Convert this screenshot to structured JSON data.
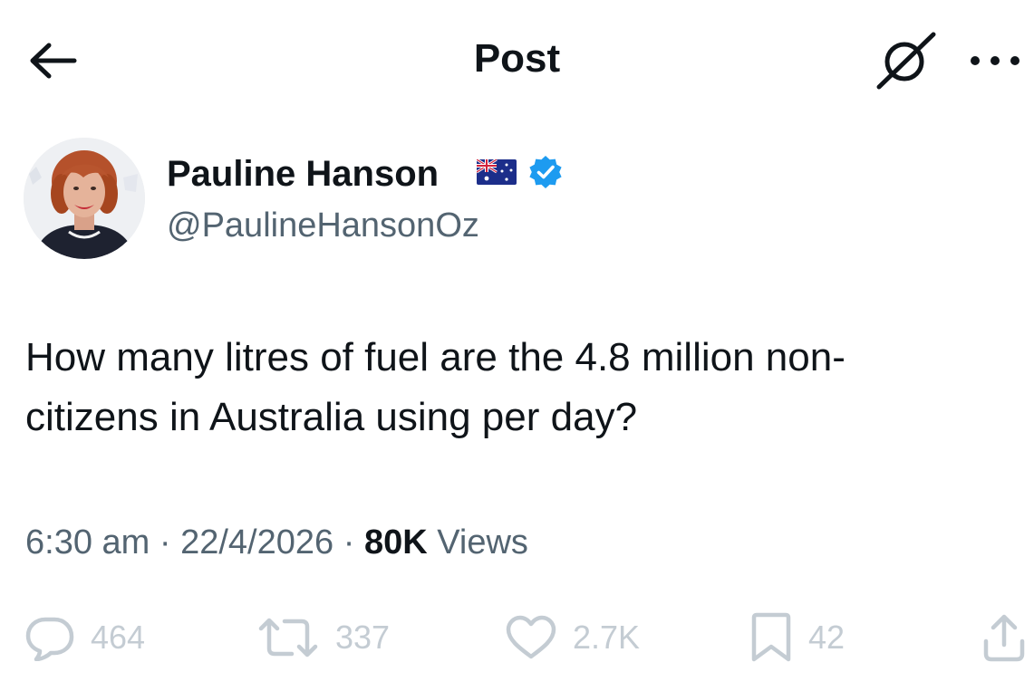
{
  "header": {
    "title": "Post",
    "back_icon": "arrow-left-icon",
    "grok_icon": "grok-icon",
    "more_icon": "more-horizontal-icon"
  },
  "author": {
    "name": "Pauline Hanson",
    "handle": "@PaulineHansonOz",
    "flag": "australian-flag-emoji",
    "verified": true,
    "verified_color": "#1d9bf0"
  },
  "tweet": {
    "text_line1": "How many litres of fuel are the 4.8 million non-",
    "text_line2": "citizens in Australia using per day?"
  },
  "meta": {
    "time": "6:30 am",
    "separator": "·",
    "date": "22/4/2026",
    "views_count": "80K",
    "views_label": "Views"
  },
  "actions": {
    "replies": "464",
    "reposts": "337",
    "likes": "2.7K",
    "bookmarks": "42"
  },
  "colors": {
    "text": "#0f1419",
    "secondary": "#536471",
    "action_muted": "#c4ccd3",
    "background": "#ffffff"
  }
}
